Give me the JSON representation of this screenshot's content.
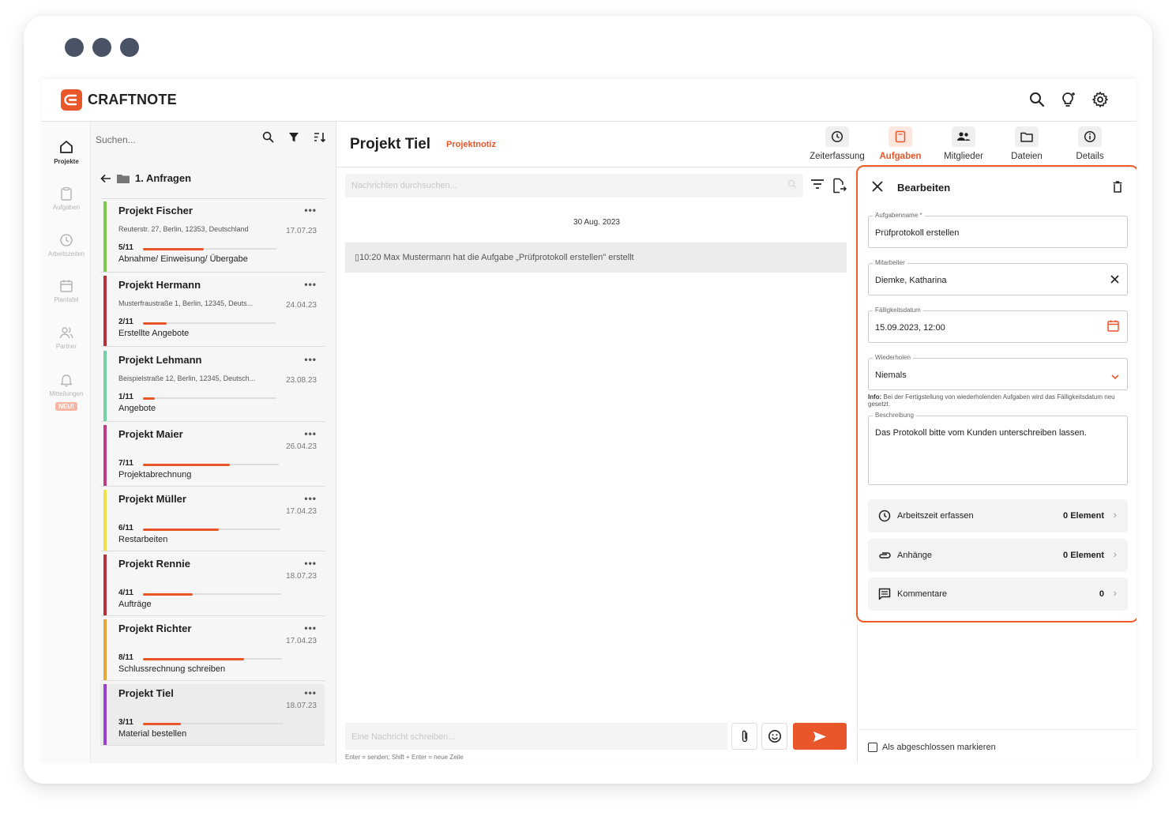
{
  "brand": {
    "name": "CRAFTNOTE",
    "accent": "#e8562a"
  },
  "rail": [
    {
      "label": "Projekte",
      "icon": "home-icon"
    },
    {
      "label": "Aufgaben",
      "icon": "clipboard-icon"
    },
    {
      "label": "Arbeitszeiten",
      "icon": "clock-icon"
    },
    {
      "label": "Plantafel",
      "icon": "calendar-icon"
    },
    {
      "label": "Partner",
      "icon": "partner-icon"
    },
    {
      "label": "Mitteilungen",
      "icon": "bell-icon",
      "badge": "NEU!"
    }
  ],
  "list": {
    "search_placeholder": "Suchen...",
    "folder": "1. Anfragen",
    "projects": [
      {
        "name": "Projekt Fischer",
        "address": "Reuterstr. 27, Berlin, 12353, Deutschland",
        "date": "17.07.23",
        "count": "5/11",
        "progress": 0.45,
        "stage": "Abnahme/ Einweisung/ Übergabe",
        "color": "#7ec84a"
      },
      {
        "name": "Projekt Hermann",
        "address": "Musterfraustraße 1, Berlin, 12345, Deuts...",
        "date": "24.04.23",
        "count": "2/11",
        "progress": 0.18,
        "stage": "Erstellte Angebote",
        "color": "#b5313a"
      },
      {
        "name": "Projekt Lehmann",
        "address": "Beispielstraße 12, Berlin, 12345, Deutsch...",
        "date": "23.08.23",
        "count": "1/11",
        "progress": 0.09,
        "stage": "Angebote",
        "color": "#6fd3a6"
      },
      {
        "name": "Projekt Maier",
        "address": "",
        "date": "26.04.23",
        "count": "7/11",
        "progress": 0.64,
        "stage": "Projektabrechnung",
        "color": "#c23b87"
      },
      {
        "name": "Projekt Müller",
        "address": "",
        "date": "17.04.23",
        "count": "6/11",
        "progress": 0.55,
        "stage": "Restarbeiten",
        "color": "#f0e14b"
      },
      {
        "name": "Projekt Rennie",
        "address": "",
        "date": "18.07.23",
        "count": "4/11",
        "progress": 0.36,
        "stage": "Aufträge",
        "color": "#b5313a"
      },
      {
        "name": "Projekt Richter",
        "address": "",
        "date": "17.04.23",
        "count": "8/11",
        "progress": 0.73,
        "stage": "Schlussrechnung schreiben",
        "color": "#e3a93a"
      },
      {
        "name": "Projekt Tiel",
        "address": "",
        "date": "18.07.23",
        "count": "3/11",
        "progress": 0.27,
        "stage": "Material bestellen",
        "color": "#9b3fd0"
      }
    ],
    "fab": "+"
  },
  "header": {
    "title": "Projekt Tiel",
    "tag": "Projektnotiz",
    "tabs": [
      {
        "label": "Zeiterfassung",
        "icon": "clock-icon"
      },
      {
        "label": "Aufgaben",
        "icon": "clipboard-icon",
        "active": true
      },
      {
        "label": "Mitglieder",
        "icon": "members-icon"
      },
      {
        "label": "Dateien",
        "icon": "folder-icon"
      },
      {
        "label": "Details",
        "icon": "info-icon"
      }
    ]
  },
  "chat": {
    "search_placeholder": "Nachrichten durchsuchen...",
    "date": "30 Aug. 2023",
    "message": "10:20 Max Mustermann hat die Aufgabe „Prüfprotokoll erstellen\" erstellt",
    "composer_placeholder": "Eine Nachricht schreiben...",
    "hint": "Enter = senden; Shift + Enter = neue Zeile"
  },
  "task": {
    "title": "Bearbeiten",
    "fields": [
      {
        "label": "Aufgabenname *",
        "value": "Prüfprotokoll erstellen"
      },
      {
        "label": "Mitarbeiter",
        "value": "Diemke, Katharina"
      },
      {
        "label": "Fälligkeitsdatum",
        "value": "15.09.2023, 12:00"
      },
      {
        "label": "Wiederholen",
        "value": "Niemals"
      }
    ],
    "info_bold": "Info:",
    "info": " Bei der Fertigstellung von wiederholenden Aufgaben wird das Fälligkeitsdatum neu gesetzt.",
    "description_label": "Beschreibung",
    "description": "Das Protokoll bitte vom Kunden unterschreiben lassen.",
    "rows": [
      {
        "label": "Arbeitszeit erfassen",
        "count": "0 Element"
      },
      {
        "label": "Anhänge",
        "count": "0 Element"
      },
      {
        "label": "Kommentare",
        "count": "0"
      }
    ],
    "complete_label": "Als abgeschlossen markieren"
  }
}
